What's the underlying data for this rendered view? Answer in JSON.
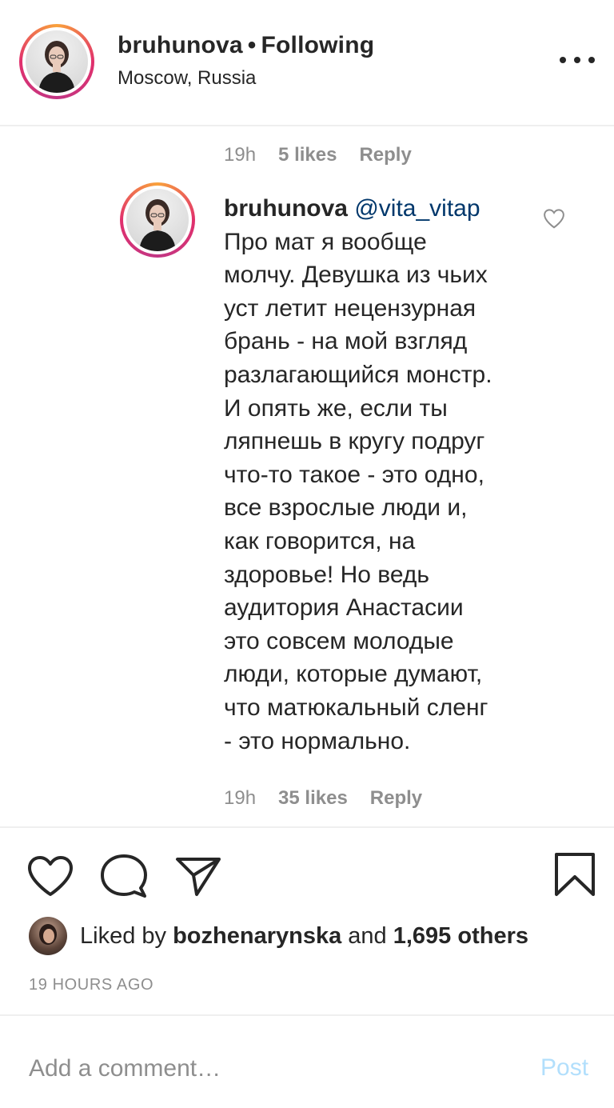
{
  "header": {
    "username": "bruhunova",
    "separator": "•",
    "follow_status": "Following",
    "location": "Moscow, Russia"
  },
  "prev_comment": {
    "time": "19h",
    "likes": "5 likes",
    "reply": "Reply"
  },
  "comment": {
    "username": "bruhunova",
    "mention": "@vita_vitap",
    "lines": [
      "Про мат я вообще",
      "молчу. Девушка из чьих",
      "уст летит нецензурная",
      "брань - на мой взгляд",
      "разлагающийся монстр.",
      "И опять же, если ты",
      "ляпнешь в кругу подруг",
      "что-то такое - это одно,",
      "все взрослые люди и,",
      "как говорится, на",
      "здоровье! Но ведь",
      "аудитория Анастасии",
      "это совсем молодые",
      "люди, которые думают,",
      "что матюкальный сленг",
      "- это нормально."
    ],
    "time": "19h",
    "likes": "35 likes",
    "reply": "Reply"
  },
  "likes": {
    "prefix": "Liked by",
    "user": "bozhenarynska",
    "conj": "and",
    "others": "1,695 others"
  },
  "timestamp": "19 HOURS AGO",
  "comment_input": {
    "placeholder": "Add a comment…",
    "post_label": "Post"
  },
  "colors": {
    "text": "#262626",
    "muted": "#8e8e8e",
    "mention": "#00376b",
    "post_disabled": "#b2dffc"
  }
}
